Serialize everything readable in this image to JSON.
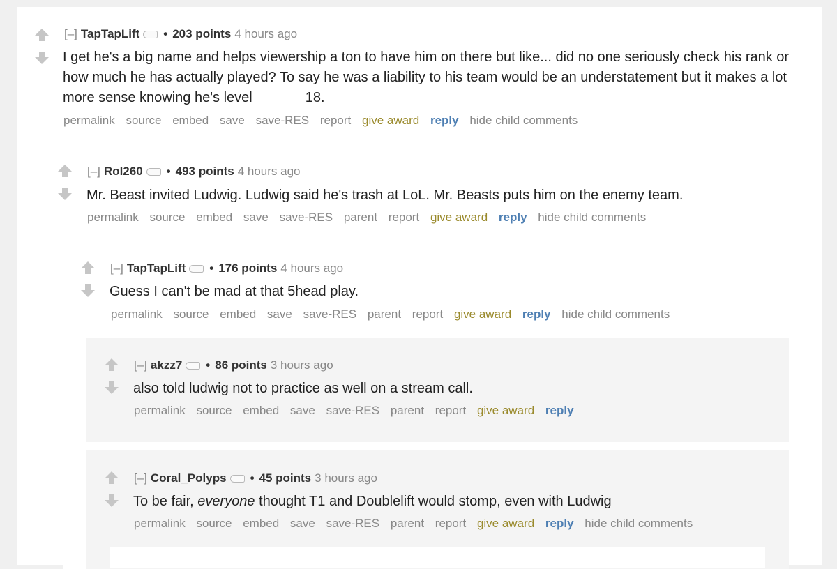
{
  "icons": {
    "upvote": "upvote-arrow-icon",
    "downvote": "downvote-arrow-icon",
    "flair": "flair-tag-icon"
  },
  "colors": {
    "award": "#9a8a2c",
    "reply": "#4e7fb3",
    "meta": "#888888"
  },
  "expand_label": "[–]",
  "bullet": "•",
  "actions": {
    "permalink": "permalink",
    "source": "source",
    "embed": "embed",
    "save": "save",
    "save_res": "save-RES",
    "parent": "parent",
    "report": "report",
    "give_award": "give award",
    "reply": "reply",
    "hide_child": "hide child comments"
  },
  "comments": [
    {
      "author": "TapTapLift",
      "score": "203 points",
      "time": "4 hours ago",
      "body_before": "I get he's a big name and helps viewership a ton to have him on there but like... did no one seriously check his rank or how much he has actually played? To say he was a liability to his team would be an understatement but it makes a lot more sense knowing he's level",
      "body_after": "18."
    },
    {
      "author": "Rol260",
      "score": "493 points",
      "time": "4 hours ago",
      "body": "Mr. Beast invited Ludwig. Ludwig said he's trash at LoL. Mr. Beasts puts him on the enemy team."
    },
    {
      "author": "TapTapLift",
      "score": "176 points",
      "time": "4 hours ago",
      "body": "Guess I can't be mad at that 5head play."
    },
    {
      "author": "akzz7",
      "score": "86 points",
      "time": "3 hours ago",
      "body": "also told ludwig not to practice as well on a stream call."
    },
    {
      "author": "Coral_Polyps",
      "score": "45 points",
      "time": "3 hours ago",
      "body_before": "To be fair, ",
      "body_em": "everyone",
      "body_after": " thought T1 and Doublelift would stomp, even with Ludwig"
    }
  ]
}
